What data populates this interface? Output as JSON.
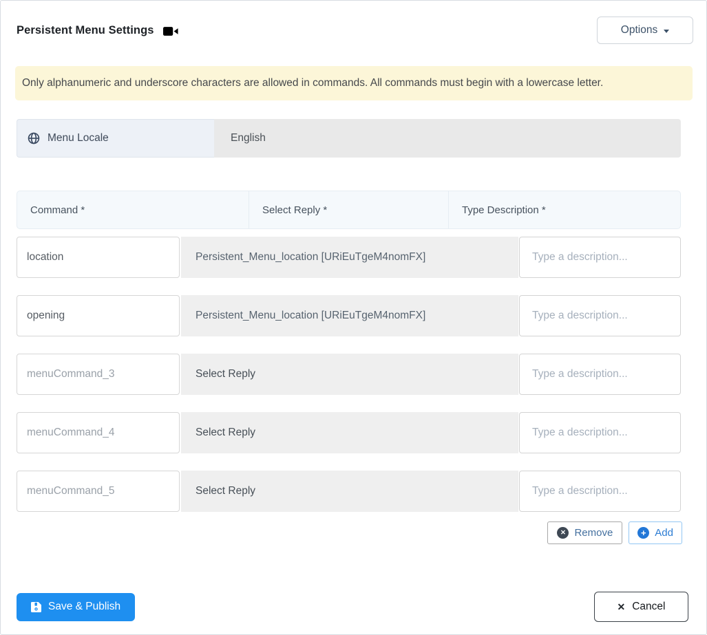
{
  "header": {
    "title": "Persistent Menu Settings",
    "options_label": "Options"
  },
  "alert": {
    "text": "Only alphanumeric and underscore characters are allowed in commands. All commands must begin with a lowercase letter."
  },
  "locale": {
    "label": "Menu Locale",
    "value": "English"
  },
  "table": {
    "headers": [
      "Command *",
      "Select Reply *",
      "Type Description *"
    ],
    "description_placeholder": "Type a description...",
    "reply_placeholder": "Select Reply",
    "rows": [
      {
        "command": "location",
        "reply": "Persistent_Menu_location [URiEuTgeM4nomFX]"
      },
      {
        "command": "opening",
        "reply": "Persistent_Menu_location [URiEuTgeM4nomFX]"
      },
      {
        "command_placeholder": "menuCommand_3",
        "reply": "Select Reply"
      },
      {
        "command_placeholder": "menuCommand_4",
        "reply": "Select Reply"
      },
      {
        "command_placeholder": "menuCommand_5",
        "reply": "Select Reply"
      }
    ]
  },
  "actions": {
    "remove_label": "Remove",
    "add_label": "Add"
  },
  "footer": {
    "save_label": "Save & Publish",
    "cancel_label": "Cancel"
  },
  "icons": {
    "title_icon": "video-camera",
    "locale_icon": "globe",
    "options_icon": "caret-down",
    "save_icon": "floppy-disk",
    "remove_glyph": "✕",
    "add_glyph": "+",
    "cancel_glyph": "✕"
  },
  "colors": {
    "primary_blue": "#1e8ff0",
    "alert_background": "#fcf6d8",
    "table_header_background": "#f5f9fc",
    "reply_cell_background": "#efefef",
    "locale_label_background": "#edf1f7",
    "locale_value_background": "#e9e9e9",
    "add_accent": "#2b7cd3",
    "remove_icon_color": "#3e4854"
  }
}
